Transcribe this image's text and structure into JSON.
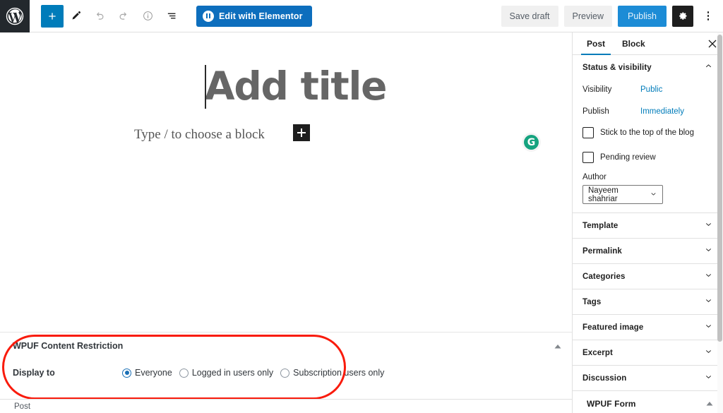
{
  "toolbar": {
    "logo_icon": "wordpress-logo-icon",
    "left_tools": [
      {
        "name": "block-inserter-button",
        "icon": "plus-icon",
        "label": "Toggle block inserter",
        "style": "primary"
      },
      {
        "name": "tools-button",
        "icon": "pencil-icon",
        "label": "Tools",
        "style": "plain"
      },
      {
        "name": "undo-button",
        "icon": "undo-icon",
        "label": "Undo",
        "style": "disabled"
      },
      {
        "name": "redo-button",
        "icon": "redo-icon",
        "label": "Redo",
        "style": "disabled"
      },
      {
        "name": "details-button",
        "icon": "info-icon",
        "label": "Details",
        "style": "plain"
      },
      {
        "name": "list-view-button",
        "icon": "list-view-icon",
        "label": "List view",
        "style": "plain"
      }
    ],
    "elementor_label": "Edit with Elementor",
    "elementor_icon": "elementor-logo-icon",
    "save_draft_label": "Save draft",
    "preview_label": "Preview",
    "publish_label": "Publish",
    "settings_icon": "gear-icon",
    "more_icon": "vertical-ellipsis-icon"
  },
  "editor": {
    "title_placeholder": "Add title",
    "paragraph_placeholder": "Type / to choose a block",
    "appender_icon": "plus-icon",
    "grammarly_icon": "grammarly-icon",
    "grammarly_glyph": "G"
  },
  "metabox": {
    "title": "WPUF Content Restriction",
    "toggle_icon": "chevron-up-icon",
    "field_label": "Display to",
    "options": [
      {
        "label": "Everyone",
        "selected": true
      },
      {
        "label": "Logged in users only",
        "selected": false
      },
      {
        "label": "Subscription users only",
        "selected": false
      }
    ]
  },
  "bottombar": {
    "breadcrumb": "Post"
  },
  "sidebar": {
    "tabs": [
      {
        "label": "Post",
        "active": true
      },
      {
        "label": "Block",
        "active": false
      }
    ],
    "close_icon": "close-icon",
    "status_panel": {
      "title": "Status & visibility",
      "chevron_icon": "chevron-up-icon",
      "rows": [
        {
          "key": "Visibility",
          "value": "Public"
        },
        {
          "key": "Publish",
          "value": "Immediately"
        }
      ],
      "checkboxes": [
        {
          "label": "Stick to the top of the blog",
          "checked": false
        },
        {
          "label": "Pending review",
          "checked": false
        }
      ],
      "author_label": "Author",
      "author_value": "Nayeem shahriar",
      "author_chevron_icon": "chevron-down-icon"
    },
    "panels": [
      {
        "label": "Template",
        "chevron_icon": "chevron-down-icon"
      },
      {
        "label": "Permalink",
        "chevron_icon": "chevron-down-icon"
      },
      {
        "label": "Categories",
        "chevron_icon": "chevron-down-icon"
      },
      {
        "label": "Tags",
        "chevron_icon": "chevron-down-icon"
      },
      {
        "label": "Featured image",
        "chevron_icon": "chevron-down-icon"
      },
      {
        "label": "Excerpt",
        "chevron_icon": "chevron-down-icon"
      },
      {
        "label": "Discussion",
        "chevron_icon": "chevron-down-icon"
      }
    ],
    "wpuf_panel": {
      "label": "WPUF Form",
      "chevron_icon": "chevron-up-icon"
    }
  },
  "colors": {
    "accent": "#007cba",
    "elementor_blue": "#0d6ebd",
    "publish_blue": "#1c8cd6",
    "highlight_red": "#f91b0c",
    "grammarly_green": "#15a37f"
  }
}
